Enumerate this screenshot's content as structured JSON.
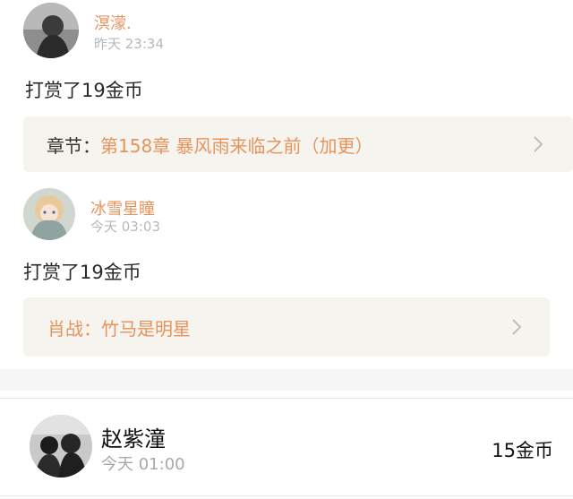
{
  "entries": [
    {
      "username": "溟濛.",
      "time": "昨天 23:34",
      "content": "打赏了19金币",
      "link_prefix": "章节：",
      "link_title": "第158章 暴风雨来临之前（加更）"
    },
    {
      "username": "冰雪星瞳",
      "time": "今天 03:03",
      "content": "打赏了19金币",
      "link_text": "肖战：竹马是明星"
    }
  ],
  "ranking": {
    "username": "赵紫潼",
    "time": "今天 01:00",
    "amount": "15金币"
  },
  "colors": {
    "accent": "#e6935c",
    "card_bg": "#f6f4ef"
  }
}
